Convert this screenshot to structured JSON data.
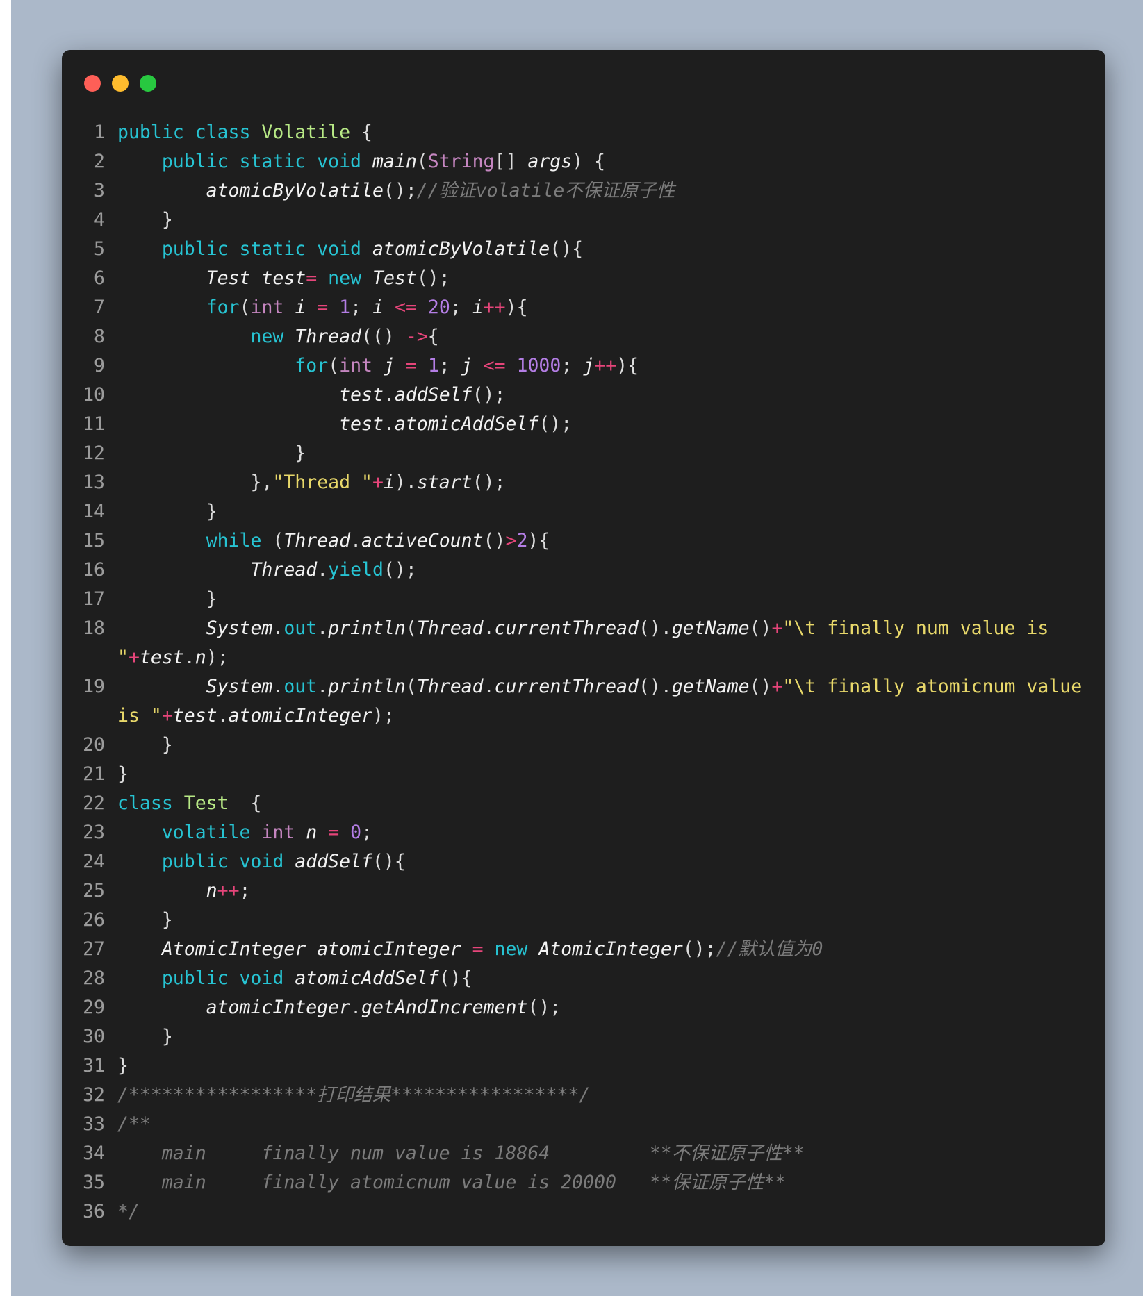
{
  "window": {
    "controls": {
      "close_color": "#fe5f57",
      "minimize_color": "#febc2e",
      "maximize_color": "#28c840"
    }
  },
  "code": {
    "language": "java",
    "lines": [
      {
        "n": "1",
        "tokens": [
          [
            "kw",
            "public class "
          ],
          [
            "cls",
            "Volatile"
          ],
          [
            "p",
            " {"
          ]
        ]
      },
      {
        "n": "2",
        "tokens": [
          [
            "p",
            "    "
          ],
          [
            "kw",
            "public static void "
          ],
          [
            "fn",
            "main"
          ],
          [
            "p",
            "("
          ],
          [
            "ty",
            "String"
          ],
          [
            "p",
            "[] "
          ],
          [
            "fn",
            "args"
          ],
          [
            "p",
            ") {"
          ]
        ]
      },
      {
        "n": "3",
        "tokens": [
          [
            "p",
            "        "
          ],
          [
            "fn",
            "atomicByVolatile"
          ],
          [
            "p",
            "();"
          ],
          [
            "cm",
            "//验证volatile不保证原子性"
          ]
        ]
      },
      {
        "n": "4",
        "tokens": [
          [
            "p",
            "    }"
          ]
        ]
      },
      {
        "n": "5",
        "tokens": [
          [
            "p",
            "    "
          ],
          [
            "kw",
            "public static void "
          ],
          [
            "fn",
            "atomicByVolatile"
          ],
          [
            "p",
            "(){"
          ]
        ]
      },
      {
        "n": "6",
        "tokens": [
          [
            "p",
            "        "
          ],
          [
            "fn",
            "Test test"
          ],
          [
            "op",
            "= "
          ],
          [
            "kw",
            "new "
          ],
          [
            "fn",
            "Test"
          ],
          [
            "p",
            "();"
          ]
        ]
      },
      {
        "n": "7",
        "tokens": [
          [
            "p",
            "        "
          ],
          [
            "kw",
            "for"
          ],
          [
            "p",
            "("
          ],
          [
            "ty",
            "int "
          ],
          [
            "fn",
            "i"
          ],
          [
            "p",
            " "
          ],
          [
            "op",
            "= "
          ],
          [
            "num",
            "1"
          ],
          [
            "p",
            "; "
          ],
          [
            "fn",
            "i"
          ],
          [
            "p",
            " "
          ],
          [
            "op",
            "<= "
          ],
          [
            "num",
            "20"
          ],
          [
            "p",
            "; "
          ],
          [
            "fn",
            "i"
          ],
          [
            "op",
            "++"
          ],
          [
            "p",
            "){"
          ]
        ]
      },
      {
        "n": "8",
        "tokens": [
          [
            "p",
            "            "
          ],
          [
            "kw",
            "new "
          ],
          [
            "fn",
            "Thread"
          ],
          [
            "p",
            "(() "
          ],
          [
            "op",
            "->"
          ],
          [
            "p",
            "{"
          ]
        ]
      },
      {
        "n": "9",
        "tokens": [
          [
            "p",
            "                "
          ],
          [
            "kw",
            "for"
          ],
          [
            "p",
            "("
          ],
          [
            "ty",
            "int "
          ],
          [
            "fn",
            "j"
          ],
          [
            "p",
            " "
          ],
          [
            "op",
            "= "
          ],
          [
            "num",
            "1"
          ],
          [
            "p",
            "; "
          ],
          [
            "fn",
            "j"
          ],
          [
            "p",
            " "
          ],
          [
            "op",
            "<= "
          ],
          [
            "num",
            "1000"
          ],
          [
            "p",
            "; "
          ],
          [
            "fn",
            "j"
          ],
          [
            "op",
            "++"
          ],
          [
            "p",
            "){"
          ]
        ]
      },
      {
        "n": "10",
        "tokens": [
          [
            "p",
            "                    "
          ],
          [
            "fn",
            "test"
          ],
          [
            "p",
            "."
          ],
          [
            "fn",
            "addSelf"
          ],
          [
            "p",
            "();"
          ]
        ]
      },
      {
        "n": "11",
        "tokens": [
          [
            "p",
            "                    "
          ],
          [
            "fn",
            "test"
          ],
          [
            "p",
            "."
          ],
          [
            "fn",
            "atomicAddSelf"
          ],
          [
            "p",
            "();"
          ]
        ]
      },
      {
        "n": "12",
        "tokens": [
          [
            "p",
            "                }"
          ]
        ]
      },
      {
        "n": "13",
        "tokens": [
          [
            "p",
            "            },"
          ],
          [
            "str",
            "\"Thread \""
          ],
          [
            "op",
            "+"
          ],
          [
            "fn",
            "i"
          ],
          [
            "p",
            ")."
          ],
          [
            "fn",
            "start"
          ],
          [
            "p",
            "();"
          ]
        ]
      },
      {
        "n": "14",
        "tokens": [
          [
            "p",
            "        }"
          ]
        ]
      },
      {
        "n": "15",
        "tokens": [
          [
            "p",
            "        "
          ],
          [
            "kw",
            "while "
          ],
          [
            "p",
            "("
          ],
          [
            "fn",
            "Thread"
          ],
          [
            "p",
            "."
          ],
          [
            "fn",
            "activeCount"
          ],
          [
            "p",
            "()"
          ],
          [
            "op",
            ">"
          ],
          [
            "num",
            "2"
          ],
          [
            "p",
            "){"
          ]
        ]
      },
      {
        "n": "16",
        "tokens": [
          [
            "p",
            "            "
          ],
          [
            "fn",
            "Thread"
          ],
          [
            "p",
            "."
          ],
          [
            "fld",
            "yield"
          ],
          [
            "p",
            "();"
          ]
        ]
      },
      {
        "n": "17",
        "tokens": [
          [
            "p",
            "        }"
          ]
        ]
      },
      {
        "n": "18",
        "tokens": [
          [
            "p",
            "        "
          ],
          [
            "fn",
            "System"
          ],
          [
            "p",
            "."
          ],
          [
            "fld",
            "out"
          ],
          [
            "p",
            "."
          ],
          [
            "fn",
            "println"
          ],
          [
            "p",
            "("
          ],
          [
            "fn",
            "Thread"
          ],
          [
            "p",
            "."
          ],
          [
            "fn",
            "currentThread"
          ],
          [
            "p",
            "()."
          ],
          [
            "fn",
            "getName"
          ],
          [
            "p",
            "()"
          ],
          [
            "op",
            "+"
          ],
          [
            "str",
            "\"\\t finally num value is \""
          ],
          [
            "op",
            "+"
          ],
          [
            "fn",
            "test"
          ],
          [
            "p",
            "."
          ],
          [
            "fn",
            "n"
          ],
          [
            "p",
            ");"
          ]
        ]
      },
      {
        "n": "19",
        "tokens": [
          [
            "p",
            "        "
          ],
          [
            "fn",
            "System"
          ],
          [
            "p",
            "."
          ],
          [
            "fld",
            "out"
          ],
          [
            "p",
            "."
          ],
          [
            "fn",
            "println"
          ],
          [
            "p",
            "("
          ],
          [
            "fn",
            "Thread"
          ],
          [
            "p",
            "."
          ],
          [
            "fn",
            "currentThread"
          ],
          [
            "p",
            "()."
          ],
          [
            "fn",
            "getName"
          ],
          [
            "p",
            "()"
          ],
          [
            "op",
            "+"
          ],
          [
            "str",
            "\"\\t finally atomicnum value is \""
          ],
          [
            "op",
            "+"
          ],
          [
            "fn",
            "test"
          ],
          [
            "p",
            "."
          ],
          [
            "fn",
            "atomicInteger"
          ],
          [
            "p",
            ");"
          ]
        ]
      },
      {
        "n": "20",
        "tokens": [
          [
            "p",
            "    }"
          ]
        ]
      },
      {
        "n": "21",
        "tokens": [
          [
            "p",
            "}"
          ]
        ]
      },
      {
        "n": "22",
        "tokens": [
          [
            "kw",
            "class "
          ],
          [
            "cls",
            "Test"
          ],
          [
            "p",
            "  {"
          ]
        ]
      },
      {
        "n": "23",
        "tokens": [
          [
            "p",
            "    "
          ],
          [
            "kw",
            "volatile "
          ],
          [
            "ty",
            "int "
          ],
          [
            "fn",
            "n"
          ],
          [
            "p",
            " "
          ],
          [
            "op",
            "= "
          ],
          [
            "num",
            "0"
          ],
          [
            "p",
            ";"
          ]
        ]
      },
      {
        "n": "24",
        "tokens": [
          [
            "p",
            "    "
          ],
          [
            "kw",
            "public void "
          ],
          [
            "fn",
            "addSelf"
          ],
          [
            "p",
            "(){"
          ]
        ]
      },
      {
        "n": "25",
        "tokens": [
          [
            "p",
            "        "
          ],
          [
            "fn",
            "n"
          ],
          [
            "op",
            "++"
          ],
          [
            "p",
            ";"
          ]
        ]
      },
      {
        "n": "26",
        "tokens": [
          [
            "p",
            "    }"
          ]
        ]
      },
      {
        "n": "27",
        "tokens": [
          [
            "p",
            "    "
          ],
          [
            "fn",
            "AtomicInteger atomicInteger"
          ],
          [
            "p",
            " "
          ],
          [
            "op",
            "= "
          ],
          [
            "kw",
            "new "
          ],
          [
            "fn",
            "AtomicInteger"
          ],
          [
            "p",
            "();"
          ],
          [
            "cm",
            "//默认值为0"
          ]
        ]
      },
      {
        "n": "28",
        "tokens": [
          [
            "p",
            "    "
          ],
          [
            "kw",
            "public void "
          ],
          [
            "fn",
            "atomicAddSelf"
          ],
          [
            "p",
            "(){"
          ]
        ]
      },
      {
        "n": "29",
        "tokens": [
          [
            "p",
            "        "
          ],
          [
            "fn",
            "atomicInteger"
          ],
          [
            "p",
            "."
          ],
          [
            "fn",
            "getAndIncrement"
          ],
          [
            "p",
            "();"
          ]
        ]
      },
      {
        "n": "30",
        "tokens": [
          [
            "p",
            "    }"
          ]
        ]
      },
      {
        "n": "31",
        "tokens": [
          [
            "p",
            "}"
          ]
        ]
      },
      {
        "n": "32",
        "tokens": [
          [
            "cm",
            "/*****************打印结果*****************/"
          ]
        ]
      },
      {
        "n": "33",
        "tokens": [
          [
            "cm",
            "/**"
          ]
        ]
      },
      {
        "n": "34",
        "tokens": [
          [
            "cm",
            "    main     finally num value is 18864         **不保证原子性**"
          ]
        ]
      },
      {
        "n": "35",
        "tokens": [
          [
            "cm",
            "    main     finally atomicnum value is 20000   **保证原子性**"
          ]
        ]
      },
      {
        "n": "36",
        "tokens": [
          [
            "cm",
            "*/"
          ]
        ]
      }
    ]
  }
}
